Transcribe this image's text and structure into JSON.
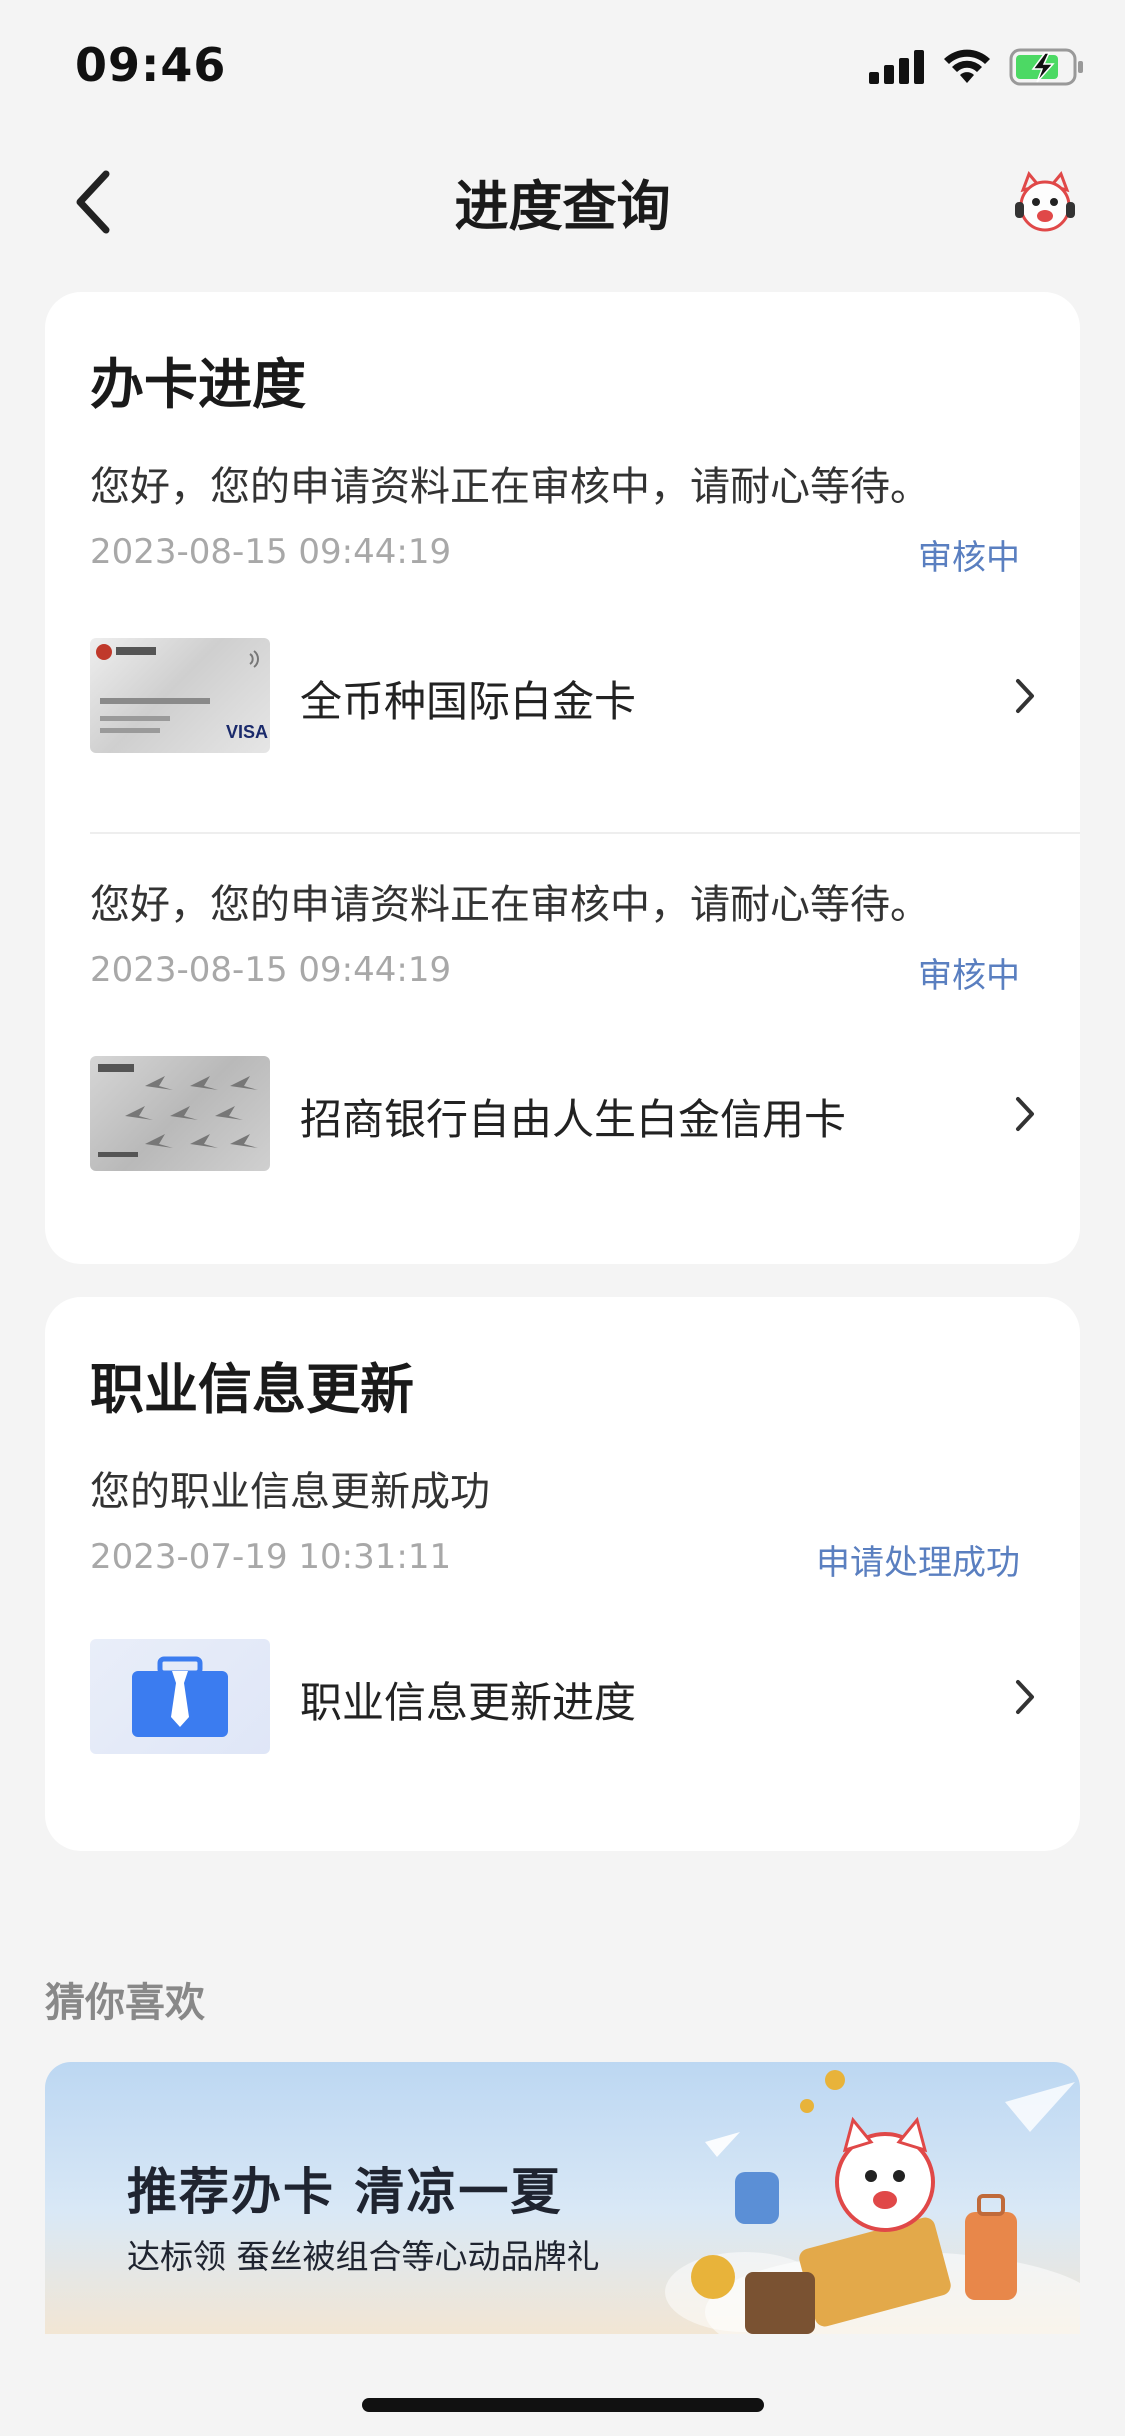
{
  "status_bar": {
    "time": "09:46"
  },
  "nav": {
    "title": "进度查询"
  },
  "card_application": {
    "title": "办卡进度",
    "entries": [
      {
        "message": "您好，您的申请资料正在审核中，请耐心等待。",
        "time": "2023-08-15 09:44:19",
        "status": "审核中",
        "card_name": "全币种国际白金卡"
      },
      {
        "message": "您好，您的申请资料正在审核中，请耐心等待。",
        "time": "2023-08-15 09:44:19",
        "status": "审核中",
        "card_name": "招商银行自由人生白金信用卡"
      }
    ]
  },
  "card_occupation": {
    "title": "职业信息更新",
    "message": "您的职业信息更新成功",
    "time": "2023-07-19 10:31:11",
    "status": "申请处理成功",
    "item_label": "职业信息更新进度"
  },
  "recommend": {
    "section_title": "猜你喜欢",
    "banner_title": "推荐办卡 清凉一夏",
    "banner_subtitle": "达标领 蚕丝被组合等心动品牌礼"
  },
  "colors": {
    "accent_status": "#5a7fc0",
    "background": "#f4f4f4",
    "card": "#ffffff"
  },
  "icons": [
    "back-icon",
    "customer-service-avatar-icon",
    "signal-icon",
    "wifi-icon",
    "battery-charging-icon",
    "chevron-right-icon",
    "briefcase-icon"
  ]
}
